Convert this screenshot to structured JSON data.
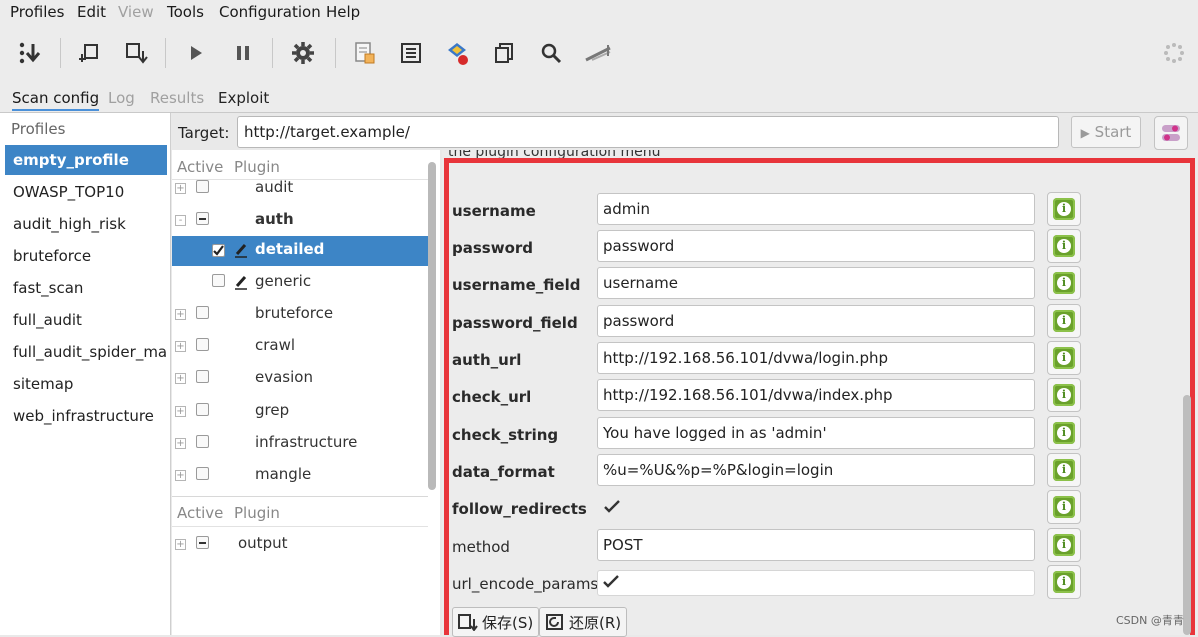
{
  "menu": [
    {
      "label": "Profiles",
      "enabled": true
    },
    {
      "label": "Edit",
      "enabled": true
    },
    {
      "label": "View",
      "enabled": false
    },
    {
      "label": "Tools",
      "enabled": true
    },
    {
      "label": "Configuration",
      "enabled": true
    },
    {
      "label": "Help",
      "enabled": true
    }
  ],
  "tabs": [
    {
      "label": "Scan config",
      "state": "active"
    },
    {
      "label": "Log",
      "state": "disabled"
    },
    {
      "label": "Results",
      "state": "disabled"
    },
    {
      "label": "Exploit",
      "state": "normal"
    }
  ],
  "profiles": {
    "header": "Profiles",
    "items": [
      "empty_profile",
      "OWASP_TOP10",
      "audit_high_risk",
      "bruteforce",
      "fast_scan",
      "full_audit",
      "full_audit_spider_man",
      "sitemap",
      "web_infrastructure"
    ],
    "selected": "empty_profile"
  },
  "target": {
    "label": "Target:",
    "value": "http://target.example/"
  },
  "start_button": "Start",
  "plugins": {
    "col_active": "Active",
    "col_plugin": "Plugin",
    "rows": [
      {
        "name": "audit",
        "expander": "+",
        "check": "off"
      },
      {
        "name": "auth",
        "expander": "-",
        "check": "partial"
      },
      {
        "name": "detailed",
        "expander": "",
        "check": "on"
      },
      {
        "name": "generic",
        "expander": "",
        "check": "off"
      },
      {
        "name": "bruteforce",
        "expander": "+",
        "check": "off"
      },
      {
        "name": "crawl",
        "expander": "+",
        "check": "off"
      },
      {
        "name": "evasion",
        "expander": "+",
        "check": "off"
      },
      {
        "name": "grep",
        "expander": "+",
        "check": "off"
      },
      {
        "name": "infrastructure",
        "expander": "+",
        "check": "off"
      },
      {
        "name": "mangle",
        "expander": "+",
        "check": "off"
      }
    ],
    "selected": "detailed",
    "output_header_active": "Active",
    "output_header_plugin": "Plugin",
    "output_row": {
      "name": "output",
      "expander": "+",
      "check": "partial"
    }
  },
  "config": {
    "header_text": "the plugin configuration menu",
    "options": [
      {
        "label": "username",
        "type": "text",
        "value": "admin"
      },
      {
        "label": "password",
        "type": "text",
        "value": "password"
      },
      {
        "label": "username_field",
        "type": "text",
        "value": "username"
      },
      {
        "label": "password_field",
        "type": "text",
        "value": "password"
      },
      {
        "label": "auth_url",
        "type": "text",
        "value": "http://192.168.56.101/dvwa/login.php"
      },
      {
        "label": "check_url",
        "type": "text",
        "value": "http://192.168.56.101/dvwa/index.php"
      },
      {
        "label": "check_string",
        "type": "text",
        "value": "You have logged in as 'admin'"
      },
      {
        "label": "data_format",
        "type": "text",
        "value": "%u=%U&%p=%P&login=login"
      },
      {
        "label": "follow_redirects",
        "type": "bool",
        "value": true
      },
      {
        "label": "method",
        "type": "text",
        "value": "POST"
      },
      {
        "label": "url_encode_params",
        "type": "bool",
        "value": true
      }
    ],
    "save_label": "保存(S)",
    "revert_label": "还原(R)"
  },
  "watermark": "CSDN @青青",
  "colors": {
    "selection": "#3d85c6",
    "highlight_border": "#e8353b",
    "info_icon": "#6aa12b"
  }
}
